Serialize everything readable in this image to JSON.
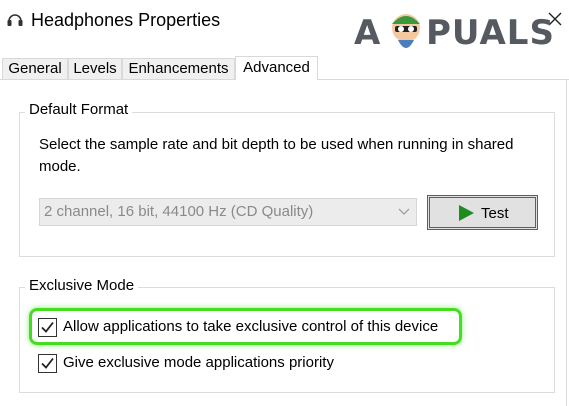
{
  "window": {
    "title": "Headphones Properties",
    "close_icon": "close-icon",
    "app_icon": "speaker-icon"
  },
  "watermark": {
    "text_left": "A",
    "text_right": "PUALS"
  },
  "tabs": [
    {
      "label": "General",
      "active": false
    },
    {
      "label": "Levels",
      "active": false
    },
    {
      "label": "Enhancements",
      "active": false
    },
    {
      "label": "Advanced",
      "active": true
    }
  ],
  "default_format": {
    "legend": "Default Format",
    "description": "Select the sample rate and bit depth to be used when running in shared mode.",
    "selected_value": "2 channel, 16 bit, 44100 Hz (CD Quality)",
    "test_label": "Test"
  },
  "exclusive_mode": {
    "legend": "Exclusive Mode",
    "options": [
      {
        "label": "Allow applications to take exclusive control of this device",
        "checked": true,
        "highlighted": true
      },
      {
        "label": "Give exclusive mode applications priority",
        "checked": true,
        "highlighted": false
      }
    ]
  },
  "colors": {
    "highlight": "#44dd22",
    "test_button_border": "#0078d7",
    "play_icon": "#1e8c1e"
  }
}
